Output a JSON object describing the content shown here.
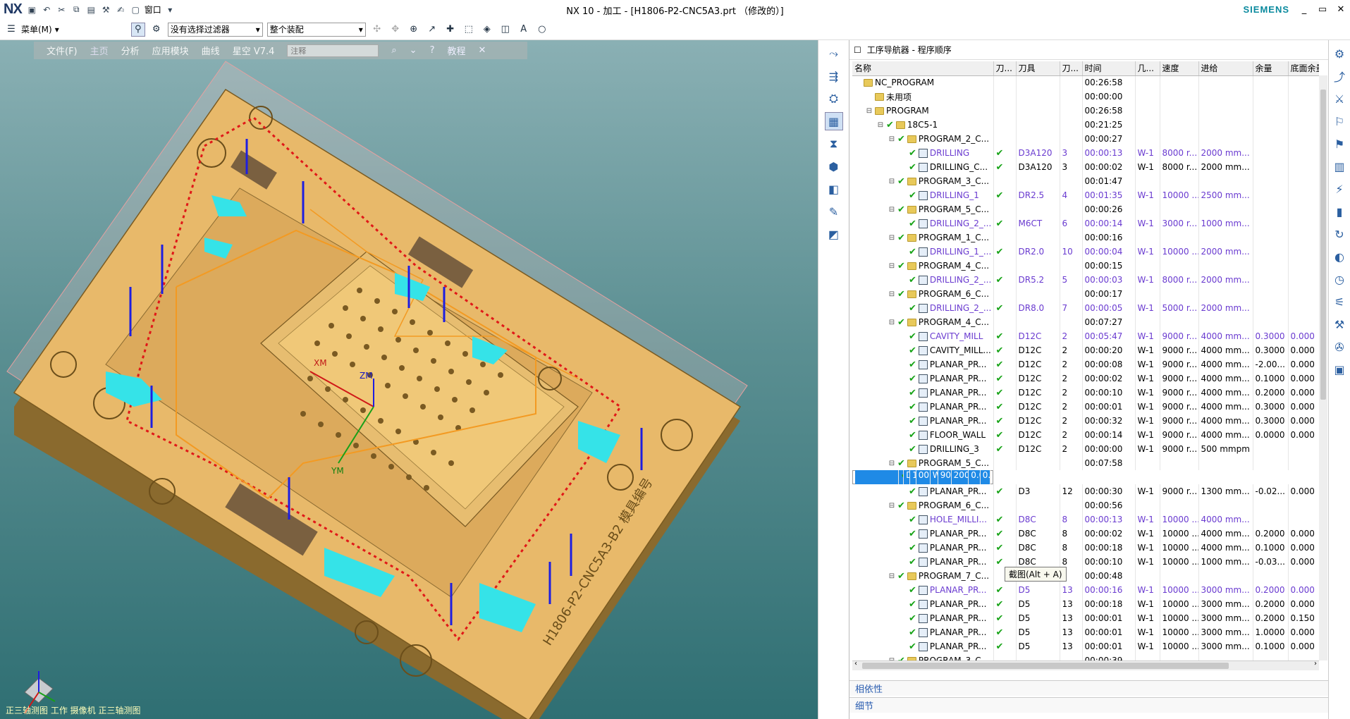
{
  "app": {
    "logo": "NX",
    "title": "NX 10 - 加工 - [H1806-P2-CNC5A3.prt （修改的）]",
    "brand": "SIEMENS"
  },
  "window_controls": [
    "_",
    "▭",
    "✕"
  ],
  "quick_access": [
    "save-icon",
    "undo-icon",
    "cut-icon",
    "copy-icon",
    "paste-icon",
    "command-icon",
    "touch-icon"
  ],
  "window_menu": {
    "label": "窗口"
  },
  "toolbar": {
    "menu_label": "菜单(M)",
    "filter_value": "没有选择过滤器",
    "assembly_value": "整个装配"
  },
  "ribbon": {
    "tabs": [
      "文件(F)",
      "主页",
      "分析",
      "应用模块",
      "曲线",
      "星空 V7.4"
    ],
    "note_placeholder": "注释",
    "tutorial": "教程"
  },
  "viewport": {
    "labels": {
      "xm": "XM",
      "ym": "YM",
      "zm": "ZM",
      "part_text": "H1806-P2-CNC5A3-B2 模具编号"
    },
    "status": "正三轴测图 工作 摄像机 正三轴测图"
  },
  "navigator": {
    "title": "工序导航器 - 程序顺序",
    "columns": [
      "名称",
      "刀...",
      "刀具",
      "刀...",
      "时间",
      "几...",
      "速度",
      "进给",
      "余量",
      "底面余量"
    ],
    "rows": [
      {
        "level": 0,
        "type": "root",
        "name": "NC_PROGRAM",
        "check": "",
        "tool": "",
        "num": "",
        "time": "00:26:58",
        "geom": "",
        "speed": "",
        "feed": "",
        "stock": "",
        "floor": ""
      },
      {
        "level": 1,
        "type": "folder",
        "name": "未用项",
        "check": "",
        "tool": "",
        "num": "",
        "time": "00:00:00",
        "geom": "",
        "speed": "",
        "feed": "",
        "stock": "",
        "floor": ""
      },
      {
        "level": 1,
        "type": "folder",
        "name": "PROGRAM",
        "check": "",
        "tool": "",
        "num": "",
        "time": "00:26:58",
        "geom": "",
        "speed": "",
        "feed": "",
        "stock": "",
        "floor": ""
      },
      {
        "level": 2,
        "type": "folder",
        "name": "18C5-1",
        "check": "",
        "tool": "",
        "num": "",
        "time": "00:21:25",
        "geom": "",
        "speed": "",
        "feed": "",
        "stock": "",
        "floor": ""
      },
      {
        "level": 3,
        "type": "folder",
        "name": "PROGRAM_2_C...",
        "check": "",
        "tool": "",
        "num": "",
        "time": "00:00:27",
        "geom": "",
        "speed": "",
        "feed": "",
        "stock": "",
        "floor": ""
      },
      {
        "level": 4,
        "type": "op",
        "purple": true,
        "name": "DRILLING",
        "check": "✔",
        "tool": "D3A120",
        "num": "3",
        "time": "00:00:13",
        "geom": "W-1",
        "speed": "8000 r...",
        "feed": "2000 mm...",
        "stock": "",
        "floor": ""
      },
      {
        "level": 4,
        "type": "op",
        "name": "DRILLING_C...",
        "check": "✔",
        "tool": "D3A120",
        "num": "3",
        "time": "00:00:02",
        "geom": "W-1",
        "speed": "8000 r...",
        "feed": "2000 mm...",
        "stock": "",
        "floor": ""
      },
      {
        "level": 3,
        "type": "folder",
        "name": "PROGRAM_3_C...",
        "check": "",
        "tool": "",
        "num": "",
        "time": "00:01:47",
        "geom": "",
        "speed": "",
        "feed": "",
        "stock": "",
        "floor": ""
      },
      {
        "level": 4,
        "type": "op",
        "purple": true,
        "name": "DRILLING_1",
        "check": "✔",
        "tool": "DR2.5",
        "num": "4",
        "time": "00:01:35",
        "geom": "W-1",
        "speed": "10000 ...",
        "feed": "2500 mm...",
        "stock": "",
        "floor": ""
      },
      {
        "level": 3,
        "type": "folder",
        "name": "PROGRAM_5_C...",
        "check": "",
        "tool": "",
        "num": "",
        "time": "00:00:26",
        "geom": "",
        "speed": "",
        "feed": "",
        "stock": "",
        "floor": ""
      },
      {
        "level": 4,
        "type": "op",
        "purple": true,
        "name": "DRILLING_2_...",
        "check": "✔",
        "tool": "M6CT",
        "num": "6",
        "time": "00:00:14",
        "geom": "W-1",
        "speed": "3000 r...",
        "feed": "1000 mm...",
        "stock": "",
        "floor": ""
      },
      {
        "level": 3,
        "type": "folder",
        "name": "PROGRAM_1_C...",
        "check": "",
        "tool": "",
        "num": "",
        "time": "00:00:16",
        "geom": "",
        "speed": "",
        "feed": "",
        "stock": "",
        "floor": ""
      },
      {
        "level": 4,
        "type": "op",
        "purple": true,
        "name": "DRILLING_1_...",
        "check": "✔",
        "tool": "DR2.0",
        "num": "10",
        "time": "00:00:04",
        "geom": "W-1",
        "speed": "10000 ...",
        "feed": "2000 mm...",
        "stock": "",
        "floor": ""
      },
      {
        "level": 3,
        "type": "folder",
        "name": "PROGRAM_4_C...",
        "check": "",
        "tool": "",
        "num": "",
        "time": "00:00:15",
        "geom": "",
        "speed": "",
        "feed": "",
        "stock": "",
        "floor": ""
      },
      {
        "level": 4,
        "type": "op",
        "purple": true,
        "name": "DRILLING_2_...",
        "check": "✔",
        "tool": "DR5.2",
        "num": "5",
        "time": "00:00:03",
        "geom": "W-1",
        "speed": "8000 r...",
        "feed": "2000 mm...",
        "stock": "",
        "floor": ""
      },
      {
        "level": 3,
        "type": "folder",
        "name": "PROGRAM_6_C...",
        "check": "",
        "tool": "",
        "num": "",
        "time": "00:00:17",
        "geom": "",
        "speed": "",
        "feed": "",
        "stock": "",
        "floor": ""
      },
      {
        "level": 4,
        "type": "op",
        "purple": true,
        "name": "DRILLING_2_...",
        "check": "✔",
        "tool": "DR8.0",
        "num": "7",
        "time": "00:00:05",
        "geom": "W-1",
        "speed": "5000 r...",
        "feed": "2000 mm...",
        "stock": "",
        "floor": ""
      },
      {
        "level": 3,
        "type": "folder",
        "name": "PROGRAM_4_C...",
        "check": "",
        "tool": "",
        "num": "",
        "time": "00:07:27",
        "geom": "",
        "speed": "",
        "feed": "",
        "stock": "",
        "floor": ""
      },
      {
        "level": 4,
        "type": "op",
        "purple": true,
        "name": "CAVITY_MILL",
        "check": "✔",
        "tool": "D12C",
        "num": "2",
        "time": "00:05:47",
        "geom": "W-1",
        "speed": "9000 r...",
        "feed": "4000 mm...",
        "stock": "0.3000",
        "floor": "0.000"
      },
      {
        "level": 4,
        "type": "op",
        "name": "CAVITY_MILL...",
        "check": "✔",
        "tool": "D12C",
        "num": "2",
        "time": "00:00:20",
        "geom": "W-1",
        "speed": "9000 r...",
        "feed": "4000 mm...",
        "stock": "0.3000",
        "floor": "0.000"
      },
      {
        "level": 4,
        "type": "op",
        "name": "PLANAR_PR...",
        "check": "✔",
        "tool": "D12C",
        "num": "2",
        "time": "00:00:08",
        "geom": "W-1",
        "speed": "9000 r...",
        "feed": "4000 mm...",
        "stock": "-2.00...",
        "floor": "0.000"
      },
      {
        "level": 4,
        "type": "op",
        "name": "PLANAR_PR...",
        "check": "✔",
        "tool": "D12C",
        "num": "2",
        "time": "00:00:02",
        "geom": "W-1",
        "speed": "9000 r...",
        "feed": "4000 mm...",
        "stock": "0.1000",
        "floor": "0.000"
      },
      {
        "level": 4,
        "type": "op",
        "name": "PLANAR_PR...",
        "check": "✔",
        "tool": "D12C",
        "num": "2",
        "time": "00:00:10",
        "geom": "W-1",
        "speed": "9000 r...",
        "feed": "4000 mm...",
        "stock": "0.2000",
        "floor": "0.000"
      },
      {
        "level": 4,
        "type": "op",
        "name": "PLANAR_PR...",
        "check": "✔",
        "tool": "D12C",
        "num": "2",
        "time": "00:00:01",
        "geom": "W-1",
        "speed": "9000 r...",
        "feed": "4000 mm...",
        "stock": "0.3000",
        "floor": "0.000"
      },
      {
        "level": 4,
        "type": "op",
        "name": "PLANAR_PR...",
        "check": "✔",
        "tool": "D12C",
        "num": "2",
        "time": "00:00:32",
        "geom": "W-1",
        "speed": "9000 r...",
        "feed": "4000 mm...",
        "stock": "0.3000",
        "floor": "0.000"
      },
      {
        "level": 4,
        "type": "op",
        "name": "FLOOR_WALL",
        "check": "✔",
        "tool": "D12C",
        "num": "2",
        "time": "00:00:14",
        "geom": "W-1",
        "speed": "9000 r...",
        "feed": "4000 mm...",
        "stock": "0.0000",
        "floor": "0.000"
      },
      {
        "level": 4,
        "type": "op",
        "name": "DRILLING_3",
        "check": "✔",
        "tool": "D12C",
        "num": "2",
        "time": "00:00:00",
        "geom": "W-1",
        "speed": "9000 r...",
        "feed": "500 mmpm",
        "stock": "",
        "floor": ""
      },
      {
        "level": 3,
        "type": "folder",
        "name": "PROGRAM_5_C...",
        "check": "",
        "tool": "",
        "num": "",
        "time": "00:07:58",
        "geom": "",
        "speed": "",
        "feed": "",
        "stock": "",
        "floor": ""
      },
      {
        "level": 4,
        "type": "op",
        "selected": true,
        "name": "CAVITY_MILL...",
        "check": "✔",
        "tool": "D3",
        "num": "12",
        "time": "00:07:16",
        "geom": "W-1",
        "speed": "9000 r...",
        "feed": "2000 mm...",
        "stock": "0.0000",
        "floor": "0.000"
      },
      {
        "level": 4,
        "type": "op",
        "name": "PLANAR_PR...",
        "check": "✔",
        "tool": "D3",
        "num": "12",
        "time": "00:00:30",
        "geom": "W-1",
        "speed": "9000 r...",
        "feed": "1300 mm...",
        "stock": "-0.02...",
        "floor": "0.000"
      },
      {
        "level": 3,
        "type": "folder",
        "name": "PROGRAM_6_C...",
        "check": "",
        "tool": "",
        "num": "",
        "time": "00:00:56",
        "geom": "",
        "speed": "",
        "feed": "",
        "stock": "",
        "floor": ""
      },
      {
        "level": 4,
        "type": "op",
        "purple": true,
        "name": "HOLE_MILLI...",
        "check": "✔",
        "tool": "D8C",
        "num": "8",
        "time": "00:00:13",
        "geom": "W-1",
        "speed": "10000 ...",
        "feed": "4000 mm...",
        "stock": "",
        "floor": ""
      },
      {
        "level": 4,
        "type": "op",
        "name": "PLANAR_PR...",
        "check": "✔",
        "tool": "D8C",
        "num": "8",
        "time": "00:00:02",
        "geom": "W-1",
        "speed": "10000 ...",
        "feed": "4000 mm...",
        "stock": "0.2000",
        "floor": "0.000"
      },
      {
        "level": 4,
        "type": "op",
        "name": "PLANAR_PR...",
        "check": "✔",
        "tool": "D8C",
        "num": "8",
        "time": "00:00:18",
        "geom": "W-1",
        "speed": "10000 ...",
        "feed": "4000 mm...",
        "stock": "0.1000",
        "floor": "0.000"
      },
      {
        "level": 4,
        "type": "op",
        "name": "PLANAR_PR...",
        "check": "✔",
        "tool": "D8C",
        "num": "8",
        "time": "00:00:10",
        "geom": "W-1",
        "speed": "10000 ...",
        "feed": "1000 mm...",
        "stock": "-0.03...",
        "floor": "0.000"
      },
      {
        "level": 3,
        "type": "folder",
        "name": "PROGRAM_7_C...",
        "check": "",
        "tool": "",
        "num": "",
        "time": "00:00:48",
        "geom": "",
        "speed": "",
        "feed": "",
        "stock": "",
        "floor": ""
      },
      {
        "level": 4,
        "type": "op",
        "purple": true,
        "name": "PLANAR_PR...",
        "check": "✔",
        "tool": "D5",
        "num": "13",
        "time": "00:00:16",
        "geom": "W-1",
        "speed": "10000 ...",
        "feed": "3000 mm...",
        "stock": "0.2000",
        "floor": "0.000"
      },
      {
        "level": 4,
        "type": "op",
        "name": "PLANAR_PR...",
        "check": "✔",
        "tool": "D5",
        "num": "13",
        "time": "00:00:18",
        "geom": "W-1",
        "speed": "10000 ...",
        "feed": "3000 mm...",
        "stock": "0.2000",
        "floor": "0.000"
      },
      {
        "level": 4,
        "type": "op",
        "name": "PLANAR_PR...",
        "check": "✔",
        "tool": "D5",
        "num": "13",
        "time": "00:00:01",
        "geom": "W-1",
        "speed": "10000 ...",
        "feed": "3000 mm...",
        "stock": "0.2000",
        "floor": "0.150"
      },
      {
        "level": 4,
        "type": "op",
        "name": "PLANAR_PR...",
        "check": "✔",
        "tool": "D5",
        "num": "13",
        "time": "00:00:01",
        "geom": "W-1",
        "speed": "10000 ...",
        "feed": "3000 mm...",
        "stock": "1.0000",
        "floor": "0.000"
      },
      {
        "level": 4,
        "type": "op",
        "name": "PLANAR_PR...",
        "check": "✔",
        "tool": "D5",
        "num": "13",
        "time": "00:00:01",
        "geom": "W-1",
        "speed": "10000 ...",
        "feed": "3000 mm...",
        "stock": "0.1000",
        "floor": "0.000"
      },
      {
        "level": 3,
        "type": "folder",
        "name": "PROGRAM_3_C...",
        "check": "",
        "tool": "",
        "num": "",
        "time": "00:00:39",
        "geom": "",
        "speed": "",
        "feed": "",
        "stock": "",
        "floor": ""
      }
    ],
    "tooltip": "截图(Alt + A)",
    "footer": {
      "dependencies": "相依性",
      "details": "细节"
    }
  },
  "colors": {
    "selection": "#1f8ae6",
    "purple_text": "#6a3bd0",
    "part": "#e8b96a",
    "check": "#17a317"
  }
}
